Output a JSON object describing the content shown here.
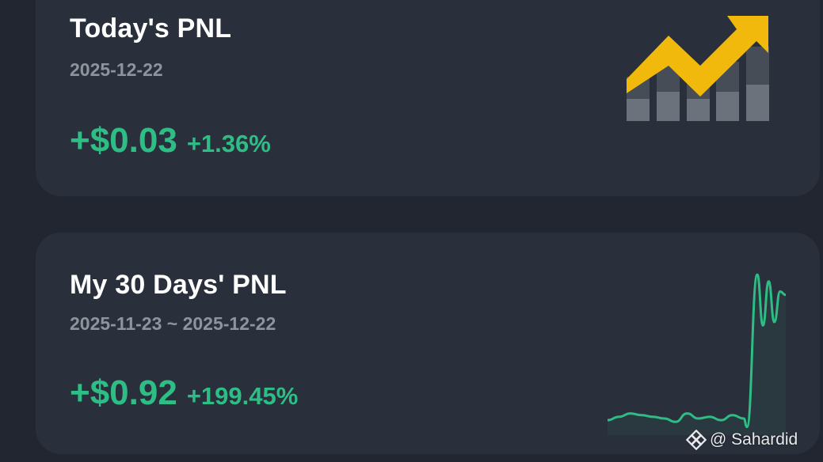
{
  "today_card": {
    "title": "Today's PNL",
    "date": "2025-12-22",
    "pnl_amount": "+$0.03",
    "pnl_percent": "+1.36%",
    "icon": "rising-bar-chart-icon"
  },
  "thirty_day_card": {
    "title": "My 30 Days' PNL",
    "date_range": "2025-11-23 ~ 2025-12-22",
    "pnl_amount": "+$0.92",
    "pnl_percent": "+199.45%",
    "sparkline_shape": [
      0.06,
      0.08,
      0.1,
      0.09,
      0.08,
      0.07,
      0.05,
      0.1,
      0.07,
      0.08,
      0.06,
      0.09,
      0.07,
      0.02,
      0.92,
      0.62,
      0.88,
      0.64,
      0.82,
      0.8
    ]
  },
  "watermark": {
    "text": "@ Sahardid",
    "icon": "binance-logo-icon"
  },
  "colors": {
    "background": "#212630",
    "card": "#29303b",
    "positive": "#2ebd85",
    "muted_text": "#8e949e",
    "arrow": "#f0b90b"
  }
}
